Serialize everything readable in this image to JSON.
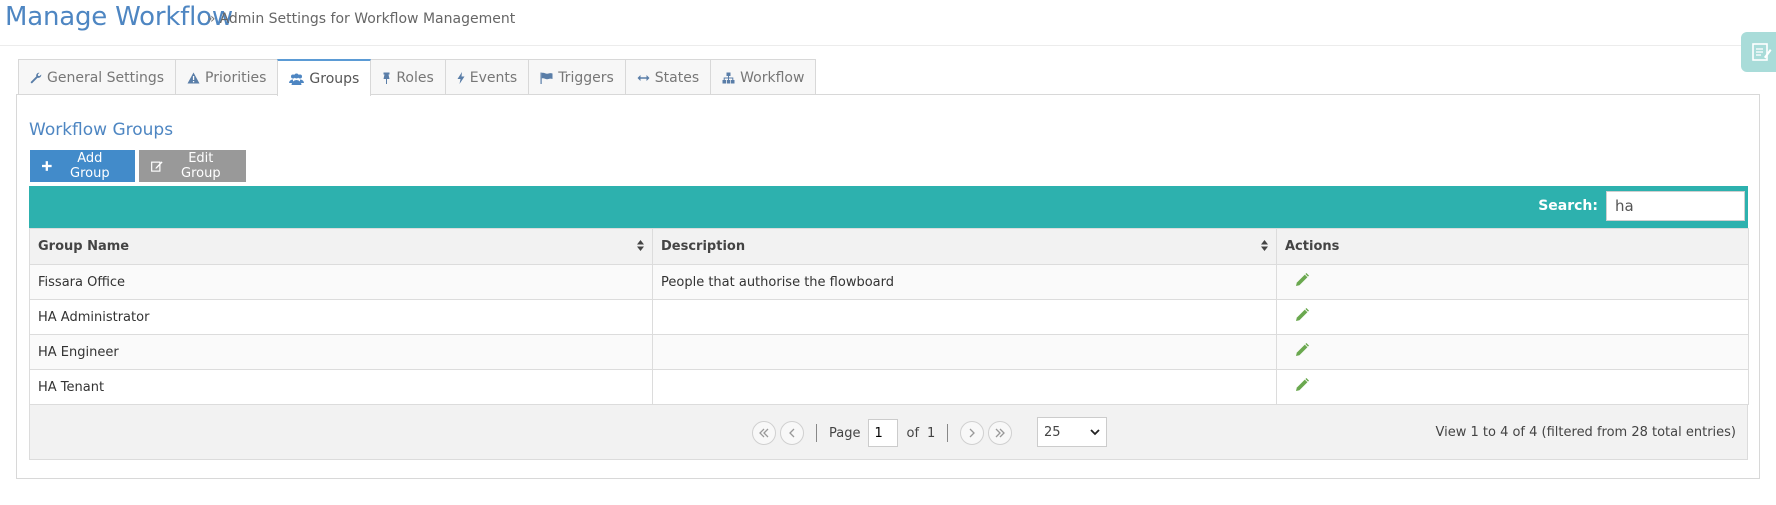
{
  "header": {
    "title": "Manage Workflow",
    "subtitle_separator": "»",
    "subtitle": "Admin Settings for Workflow Management"
  },
  "tabs": [
    {
      "label": "General Settings",
      "icon": "wrench-icon"
    },
    {
      "label": "Priorities",
      "icon": "warning-icon"
    },
    {
      "label": "Groups",
      "icon": "users-icon",
      "active": true
    },
    {
      "label": "Roles",
      "icon": "pin-icon"
    },
    {
      "label": "Events",
      "icon": "bolt-icon"
    },
    {
      "label": "Triggers",
      "icon": "flag-icon"
    },
    {
      "label": "States",
      "icon": "arrows-h-icon"
    },
    {
      "label": "Workflow",
      "icon": "sitemap-icon"
    }
  ],
  "section": {
    "title": "Workflow Groups",
    "add_button": "Add Group",
    "edit_button": "Edit Group"
  },
  "search": {
    "label": "Search:",
    "value": "ha"
  },
  "table": {
    "columns": [
      "Group Name",
      "Description",
      "Actions"
    ],
    "rows": [
      {
        "name": "Fissara Office",
        "description": "People that authorise the flowboard"
      },
      {
        "name": "HA Administrator",
        "description": ""
      },
      {
        "name": "HA Engineer",
        "description": ""
      },
      {
        "name": "HA Tenant",
        "description": ""
      }
    ]
  },
  "pager": {
    "page_label": "Page",
    "current_page": "1",
    "of_label": "of",
    "total_pages": "1",
    "page_size": "25",
    "info": "View 1 to 4 of 4 (filtered from 28 total entries)"
  },
  "colors": {
    "accent": "#4e86c2",
    "toolbar": "#2db1ae",
    "add_button": "#428bca",
    "edit_button": "#999999",
    "edit_icon": "#6aa84f"
  }
}
